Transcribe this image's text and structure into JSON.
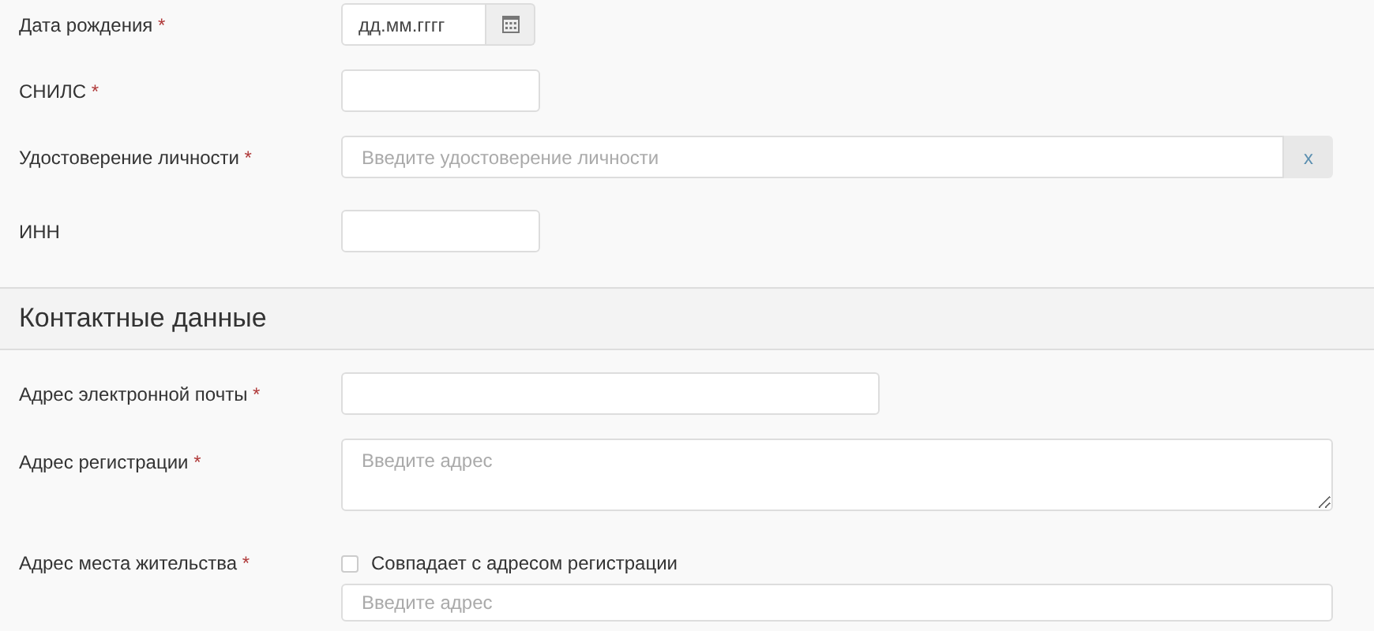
{
  "required_mark": "*",
  "personal_fields": [
    {
      "kind": "date",
      "label": "Дата рождения",
      "required": true,
      "placeholder": "дд.мм.гггг"
    },
    {
      "kind": "text",
      "label": "СНИЛС",
      "required": true
    },
    {
      "kind": "lookup",
      "label": "Удостоверение личности",
      "required": true,
      "placeholder": "Введите удостоверение личности",
      "clear_button": "x"
    },
    {
      "kind": "text",
      "label": "ИНН",
      "required": false
    }
  ],
  "contact_section": {
    "title": "Контактные данные",
    "fields": [
      {
        "kind": "email",
        "label": "Адрес электронной почты",
        "required": true
      },
      {
        "kind": "textarea",
        "label": "Адрес регистрации",
        "required": true,
        "placeholder": "Введите адрес"
      },
      {
        "kind": "address",
        "label": "Адрес места жительства",
        "required": true,
        "checkbox": {
          "label": "Совпадает с адресом регистрации",
          "checked": false
        },
        "placeholder": "Введите адрес"
      }
    ]
  }
}
